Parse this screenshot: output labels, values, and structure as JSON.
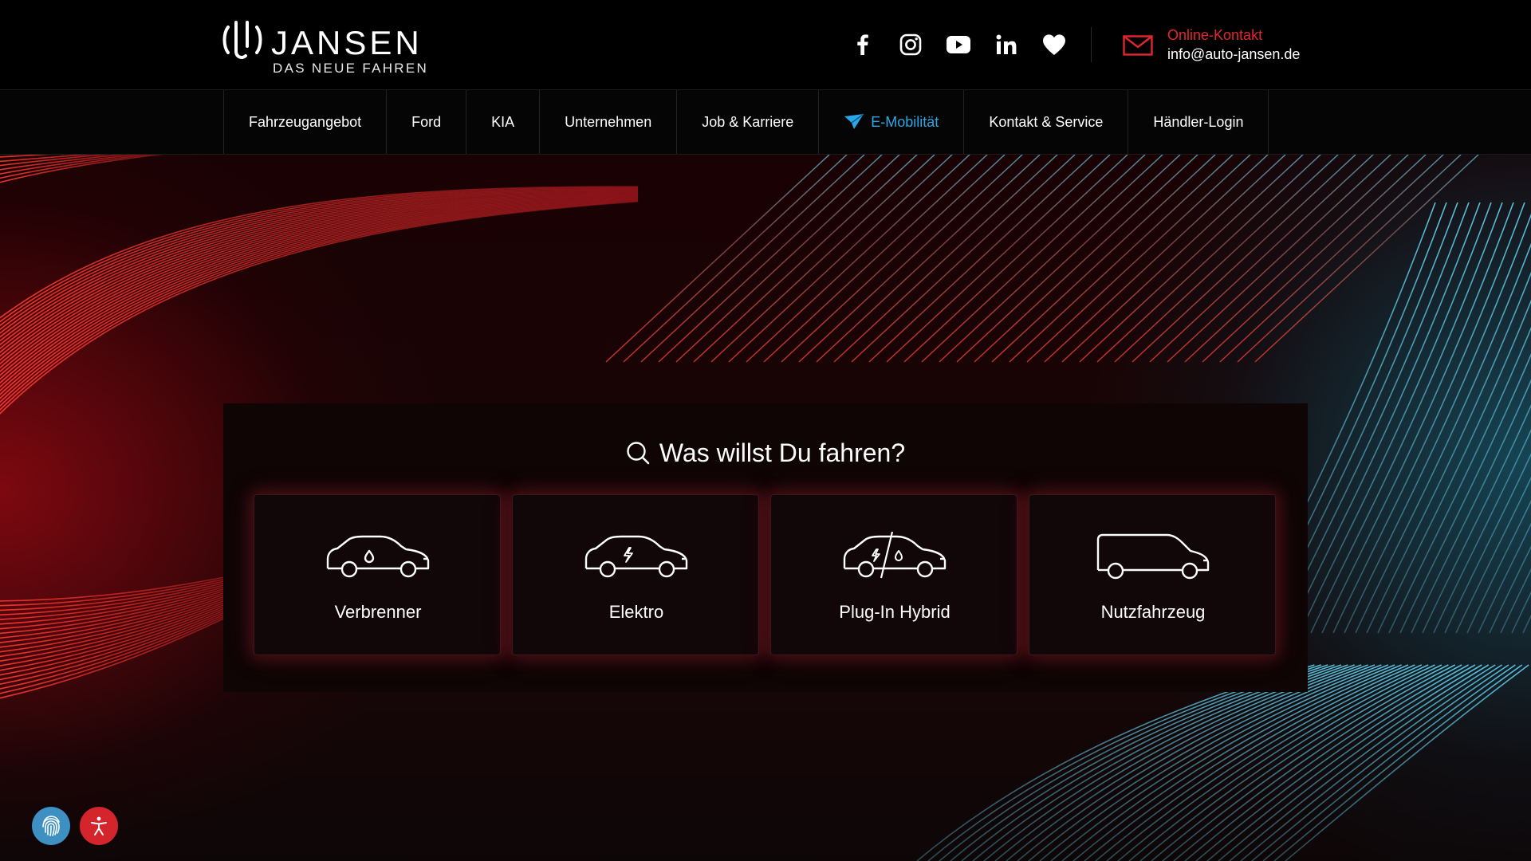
{
  "header": {
    "logo": {
      "word": "JANSEN",
      "claim": "DAS NEUE FAHREN"
    },
    "socials": [
      {
        "name": "facebook-icon"
      },
      {
        "name": "instagram-icon"
      },
      {
        "name": "youtube-icon"
      },
      {
        "name": "linkedin-icon"
      },
      {
        "name": "heart-icon"
      }
    ],
    "contact": {
      "label": "Online-Kontakt",
      "email": "info@auto-jansen.de"
    }
  },
  "nav": {
    "items": [
      {
        "label": "Fahrzeugangebot"
      },
      {
        "label": "Ford"
      },
      {
        "label": "KIA"
      },
      {
        "label": "Unternehmen"
      },
      {
        "label": "Job & Karriere"
      },
      {
        "label": "E-Mobilität",
        "active": true
      },
      {
        "label": "Kontakt & Service"
      },
      {
        "label": "Händler-Login"
      }
    ]
  },
  "search": {
    "title": "Was willst Du fahren?",
    "options": [
      {
        "label": "Verbrenner",
        "icon": "car-fuel-icon"
      },
      {
        "label": "Elektro",
        "icon": "car-electric-icon"
      },
      {
        "label": "Plug-In Hybrid",
        "icon": "car-hybrid-icon"
      },
      {
        "label": "Nutzfahrzeug",
        "icon": "van-icon"
      }
    ]
  },
  "widgets": {
    "fingerprint": "fingerprint-icon",
    "accessibility": "accessibility-icon"
  },
  "colors": {
    "accent_red": "#e3262e",
    "accent_blue": "#2aa7e6",
    "background": "#000000"
  }
}
